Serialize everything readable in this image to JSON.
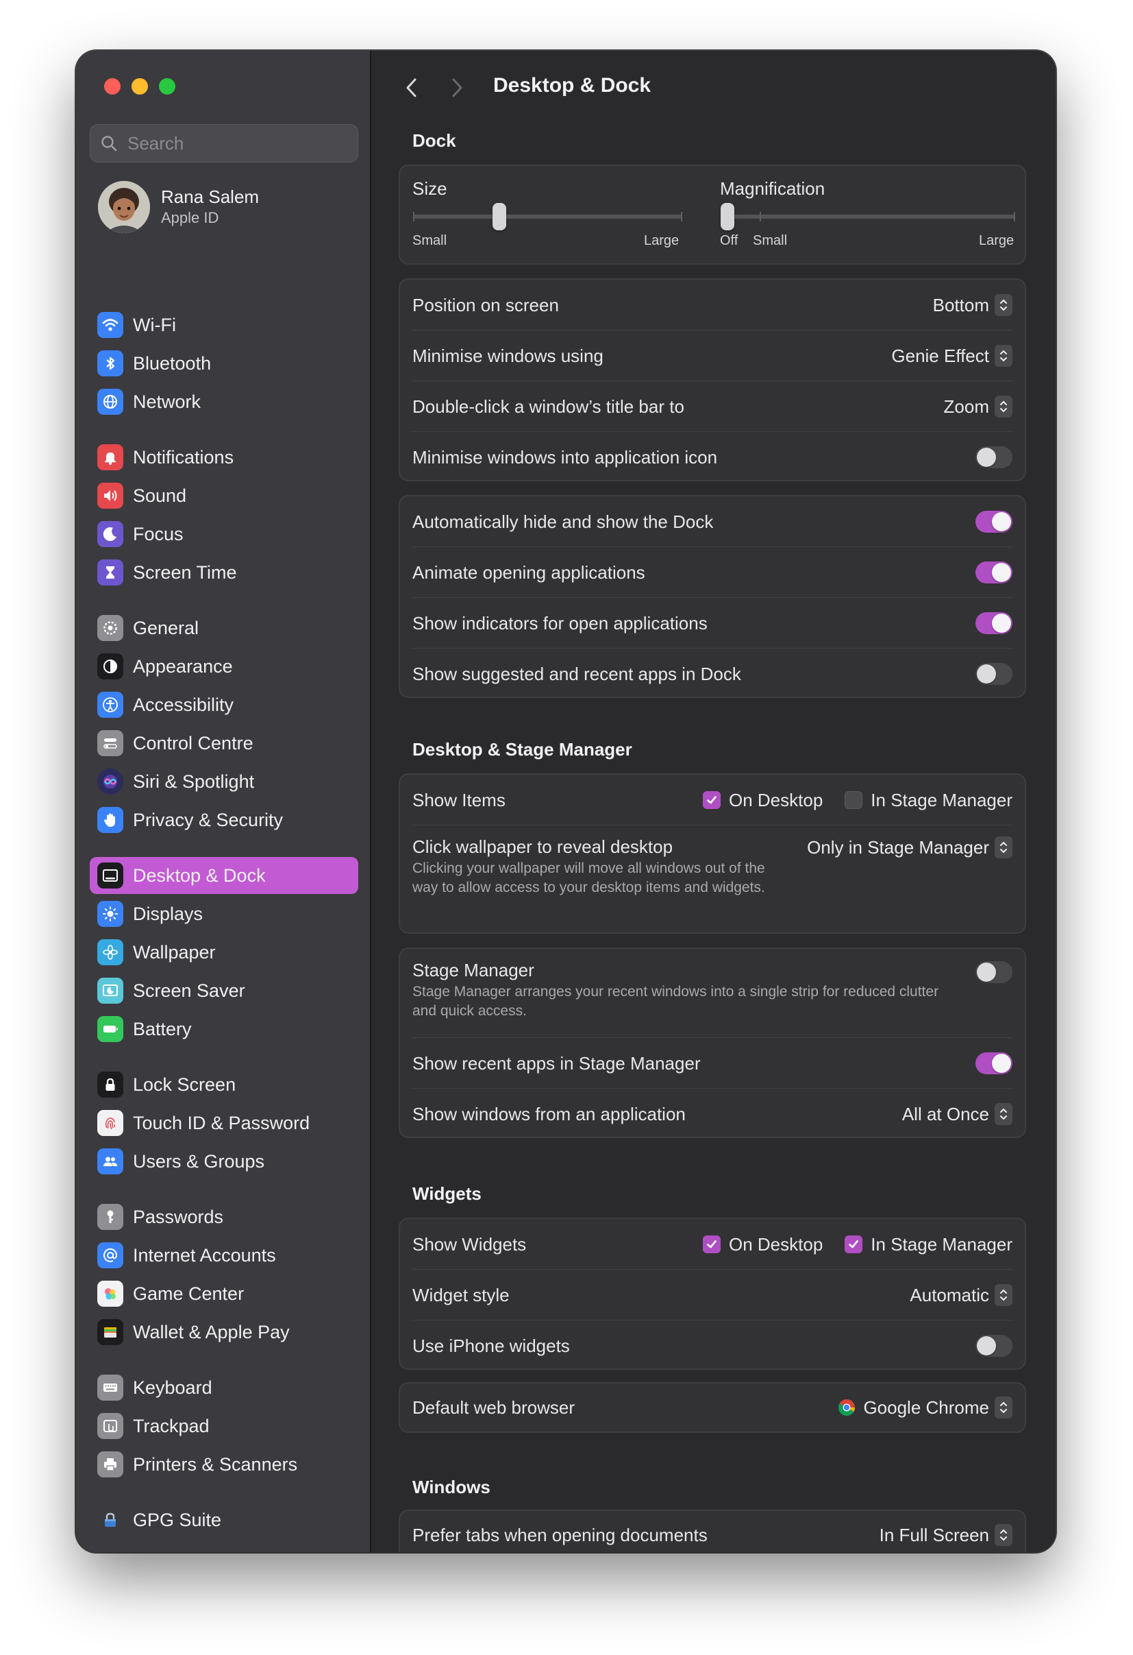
{
  "sidebar": {
    "search_placeholder": "Search",
    "profile": {
      "name": "Rana Salem",
      "subtitle": "Apple ID"
    },
    "items": [
      {
        "label": "Wi-Fi",
        "icon": "wifi-icon",
        "color": "#3b82f6"
      },
      {
        "label": "Bluetooth",
        "icon": "bluetooth-icon",
        "color": "#3b82f6"
      },
      {
        "label": "Network",
        "icon": "globe-icon",
        "color": "#3b82f6"
      },
      {
        "label": "Notifications",
        "icon": "bell-icon",
        "color": "#e5484d"
      },
      {
        "label": "Sound",
        "icon": "speaker-icon",
        "color": "#e5484d"
      },
      {
        "label": "Focus",
        "icon": "moon-icon",
        "color": "#6e56cf"
      },
      {
        "label": "Screen Time",
        "icon": "hourglass-icon",
        "color": "#6e56cf"
      },
      {
        "label": "General",
        "icon": "gear-icon",
        "color": "#8e8e93"
      },
      {
        "label": "Appearance",
        "icon": "appearance-icon",
        "color": "#1c1c1e"
      },
      {
        "label": "Accessibility",
        "icon": "accessibility-icon",
        "color": "#3b82f6"
      },
      {
        "label": "Control Centre",
        "icon": "control-centre-icon",
        "color": "#8e8e93"
      },
      {
        "label": "Siri & Spotlight",
        "icon": "siri-icon",
        "color": "#2b2b5e"
      },
      {
        "label": "Privacy & Security",
        "icon": "hand-icon",
        "color": "#3b82f6"
      },
      {
        "label": "Desktop & Dock",
        "icon": "dock-icon",
        "color": "#1c1c1e"
      },
      {
        "label": "Displays",
        "icon": "sun-icon",
        "color": "#3b82f6"
      },
      {
        "label": "Wallpaper",
        "icon": "flower-icon",
        "color": "#36a9e1"
      },
      {
        "label": "Screen Saver",
        "icon": "screen-saver-icon",
        "color": "#5ac8d8"
      },
      {
        "label": "Battery",
        "icon": "battery-icon",
        "color": "#34c759"
      },
      {
        "label": "Lock Screen",
        "icon": "lock-icon",
        "color": "#1c1c1e"
      },
      {
        "label": "Touch ID & Password",
        "icon": "fingerprint-icon",
        "color": "#f2f2f4"
      },
      {
        "label": "Users & Groups",
        "icon": "users-icon",
        "color": "#3b82f6"
      },
      {
        "label": "Passwords",
        "icon": "key-icon",
        "color": "#8e8e93"
      },
      {
        "label": "Internet Accounts",
        "icon": "at-icon",
        "color": "#3b82f6"
      },
      {
        "label": "Game Center",
        "icon": "game-center-icon",
        "color": "#f2f2f4"
      },
      {
        "label": "Wallet & Apple Pay",
        "icon": "wallet-icon",
        "color": "#1c1c1e"
      },
      {
        "label": "Keyboard",
        "icon": "keyboard-icon",
        "color": "#8e8e93"
      },
      {
        "label": "Trackpad",
        "icon": "trackpad-icon",
        "color": "#8e8e93"
      },
      {
        "label": "Printers & Scanners",
        "icon": "printer-icon",
        "color": "#8e8e93"
      },
      {
        "label": "GPG Suite",
        "icon": "gpg-lock-icon",
        "color": "#3b3a3e"
      }
    ],
    "active_item": "Desktop & Dock"
  },
  "header": {
    "title": "Desktop & Dock"
  },
  "dock": {
    "heading": "Dock",
    "size": {
      "label": "Size",
      "min_label": "Small",
      "max_label": "Large",
      "value": 0.32
    },
    "magnification": {
      "label": "Magnification",
      "off_label": "Off",
      "min_label": "Small",
      "max_label": "Large",
      "value": 0
    },
    "position": {
      "label": "Position on screen",
      "value": "Bottom"
    },
    "minimise_using": {
      "label": "Minimise windows using",
      "value": "Genie Effect"
    },
    "double_click": {
      "label": "Double-click a window’s title bar to",
      "value": "Zoom"
    },
    "minimise_into_icon": {
      "label": "Minimise windows into application icon",
      "on": false
    },
    "autohide": {
      "label": "Automatically hide and show the Dock",
      "on": true
    },
    "animate": {
      "label": "Animate opening applications",
      "on": true
    },
    "indicators": {
      "label": "Show indicators for open applications",
      "on": true
    },
    "suggested": {
      "label": "Show suggested and recent apps in Dock",
      "on": false
    }
  },
  "desktop_stage": {
    "heading": "Desktop & Stage Manager",
    "show_items": {
      "label": "Show Items",
      "on_desktop": "On Desktop",
      "on_desktop_checked": true,
      "in_stage": "In Stage Manager",
      "in_stage_checked": false
    },
    "click_wallpaper": {
      "label": "Click wallpaper to reveal desktop",
      "value": "Only in Stage Manager",
      "desc": "Clicking your wallpaper will move all windows out of the way to allow access to your desktop items and widgets."
    },
    "stage_manager": {
      "label": "Stage Manager",
      "on": false,
      "desc": "Stage Manager arranges your recent windows into a single strip for reduced clutter and quick access."
    },
    "recent_apps": {
      "label": "Show recent apps in Stage Manager",
      "on": true
    },
    "windows_from_app": {
      "label": "Show windows from an application",
      "value": "All at Once"
    }
  },
  "widgets": {
    "heading": "Widgets",
    "show_widgets": {
      "label": "Show Widgets",
      "on_desktop": "On Desktop",
      "on_desktop_checked": true,
      "in_stage": "In Stage Manager",
      "in_stage_checked": true
    },
    "style": {
      "label": "Widget style",
      "value": "Automatic"
    },
    "iphone": {
      "label": "Use iPhone widgets",
      "on": false
    }
  },
  "browser": {
    "label": "Default web browser",
    "value": "Google Chrome",
    "icon": "chrome-icon"
  },
  "windows": {
    "heading": "Windows",
    "prefer_tabs": {
      "label": "Prefer tabs when opening documents",
      "value": "In Full Screen"
    }
  },
  "colors": {
    "accent": "#b04fc3",
    "sidebar_selected": "#c25bd3"
  }
}
